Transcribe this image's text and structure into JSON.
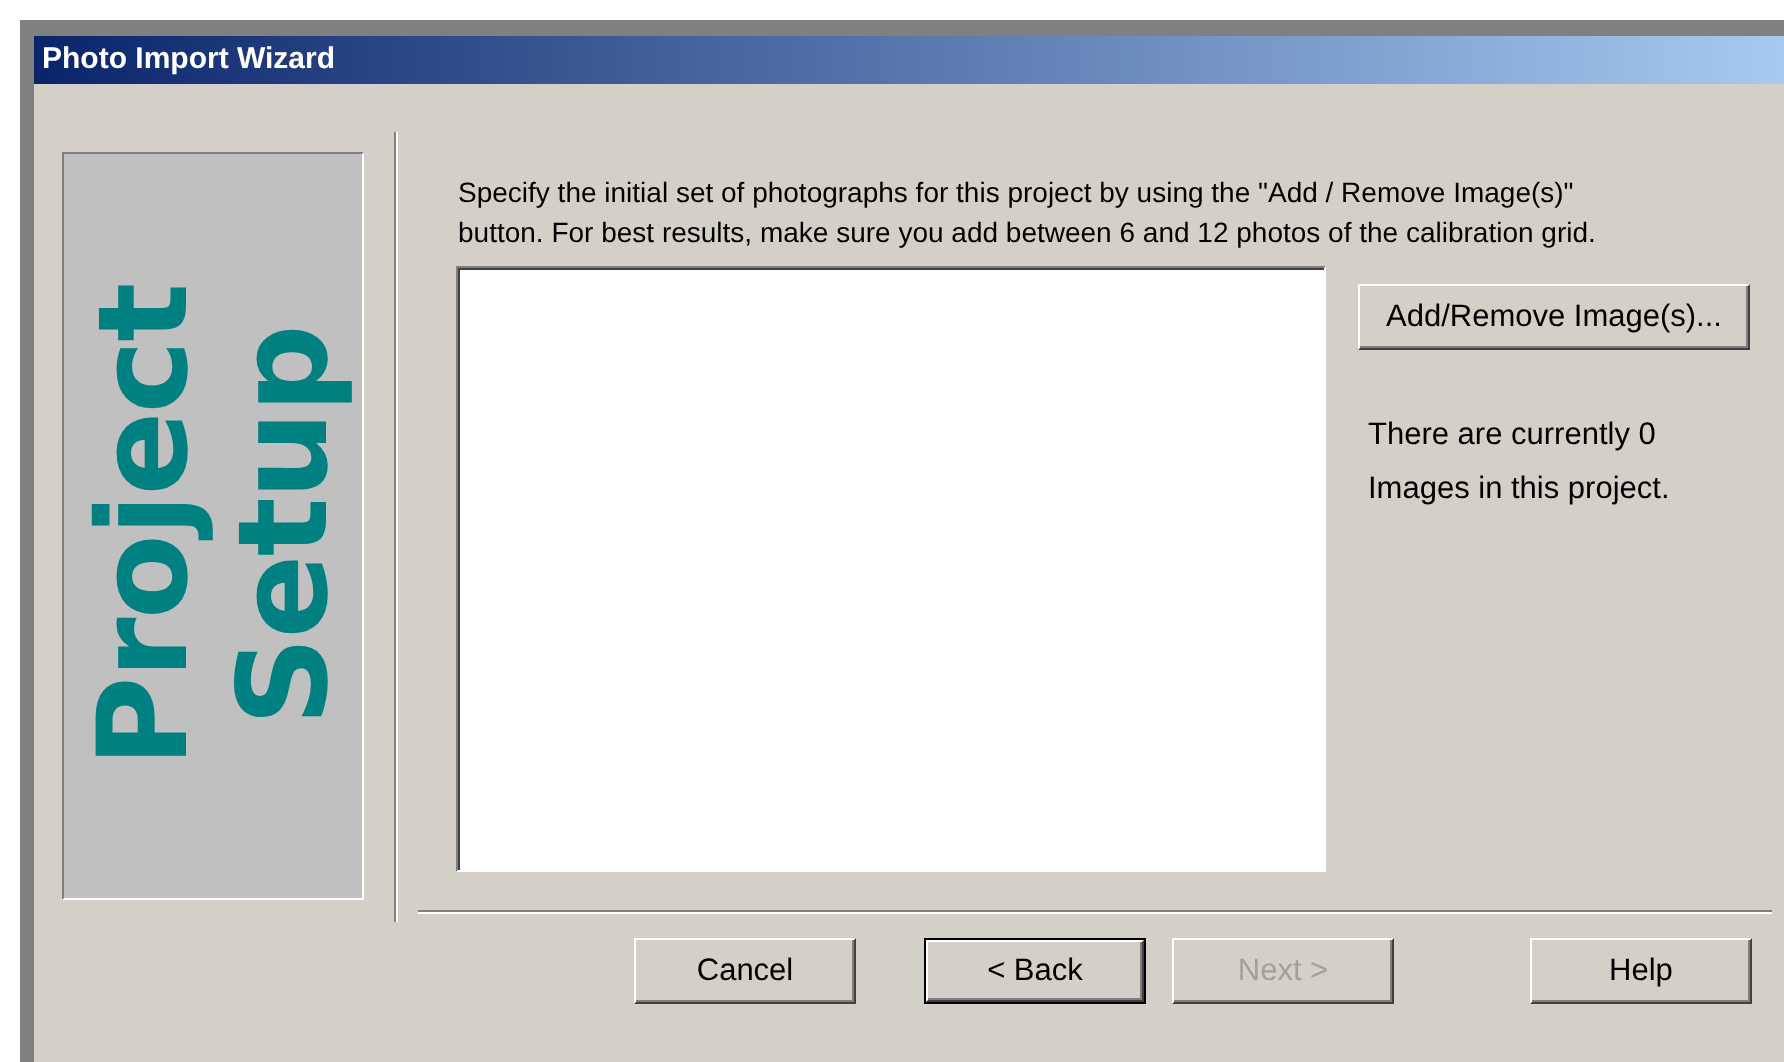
{
  "window": {
    "title": "Photo Import Wizard"
  },
  "banner": {
    "lines": [
      "Project",
      "Setup"
    ]
  },
  "instructions": "Specify the initial set of photographs for this project by using the \"Add / Remove Image(s)\" button. For best results, make sure you add between 6 and 12 photos of the calibration grid.",
  "add_remove_button": {
    "label": "Add/Remove Image(s)..."
  },
  "status_lines": [
    "There are currently 0",
    "Images in this project."
  ],
  "buttons": [
    {
      "label": "Cancel",
      "default": false,
      "disabled": false
    },
    {
      "label": "< Back",
      "default": true,
      "disabled": false
    },
    {
      "label": "Next >",
      "default": false,
      "disabled": true
    },
    {
      "label": "Help",
      "default": false,
      "disabled": false
    }
  ]
}
